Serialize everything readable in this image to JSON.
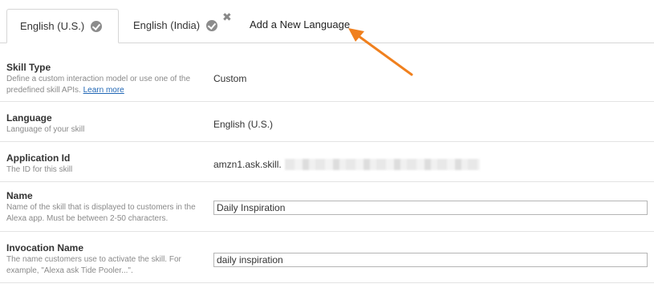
{
  "tabs": [
    {
      "label": "English (U.S.)",
      "active": true,
      "icon": "check-circle-icon"
    },
    {
      "label": "English (India)",
      "active": false,
      "icon": "check-circle-icon"
    }
  ],
  "close_symbol": "✖",
  "add_language_label": "Add a New Language",
  "annotation": {
    "color": "#f0801e"
  },
  "fields": {
    "skill_type": {
      "label": "Skill Type",
      "help": "Define a custom interaction model or use one of the predefined skill APIs.",
      "help_link": "Learn more",
      "value": "Custom"
    },
    "language": {
      "label": "Language",
      "help": "Language of your skill",
      "value": "English (U.S.)"
    },
    "application_id": {
      "label": "Application Id",
      "help": "The ID for this skill",
      "value": "amzn1.ask.skill."
    },
    "name": {
      "label": "Name",
      "help": "Name of the skill that is displayed to customers in the Alexa app. Must be between 2-50 characters.",
      "value": "Daily Inspiration"
    },
    "invocation_name": {
      "label": "Invocation Name",
      "help": "The name customers use to activate the skill. For example, \"Alexa ask Tide Pooler...\".",
      "value": "daily inspiration"
    }
  }
}
